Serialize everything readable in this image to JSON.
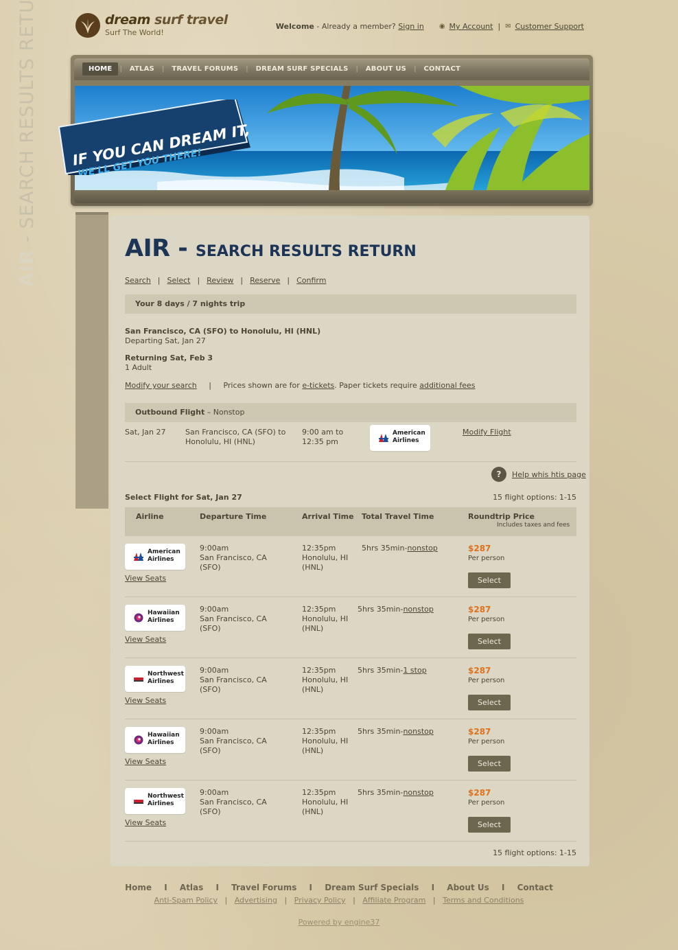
{
  "brand": {
    "name_part1": "dream",
    "name_part2": "surf travel",
    "tagline": "Surf The World!"
  },
  "topbar": {
    "welcome": "Welcome",
    "member_text": " - Already a member? ",
    "sign_in": "Sign in",
    "my_account": "My Account",
    "separator": "|",
    "customer_support": "Customer Support"
  },
  "nav": {
    "items": [
      "HOME",
      "ATLAS",
      "TRAVEL FORUMS",
      "DREAM SURF SPECIALS",
      "ABOUT US",
      "CONTACT"
    ],
    "separator": "|"
  },
  "banner": {
    "slogan_line1": "IF YOU CAN DREAM IT,",
    "slogan_line2": "WE'LL GET YOU THERE!"
  },
  "side_tab": {
    "bold": "AIR",
    "rest": " - SEARCH RESULTS RETURN"
  },
  "page": {
    "title_big": "AIR - ",
    "title_small": "SEARCH RESULTS RETURN",
    "steps": [
      "Search",
      "Select",
      "Review",
      "Reserve",
      "Confirm"
    ],
    "step_separator": "|",
    "trip_bar": "Your 8 days / 7 nights trip",
    "route_title": "San Francisco, CA (SFO) to Honolulu, HI (HNL)",
    "departing": "Departing Sat, Jan 27",
    "returning": "Returning Sat, Feb 3",
    "travelers": "1 Adult",
    "modify_search": "Modify your search",
    "prices_text": "Prices shown are for ",
    "etickets": "e-tickets",
    "paper_text": ". Paper tickets require ",
    "additional_fees": "additional fees"
  },
  "outbound": {
    "label": "Outbound Flight",
    "suffix": " – Nonstop",
    "date": "Sat, Jan 27",
    "route_line1": "San Francisco, CA (SFO) to",
    "route_line2": "Honolulu, HI (HNL)",
    "time_line1": "9:00 am to",
    "time_line2": "12:35 pm",
    "airline": "American Airlines",
    "modify": "Modify Flight"
  },
  "help": {
    "icon": "?",
    "text": "Help whis htis page"
  },
  "select": {
    "heading": "Select Flight for Sat, Jan 27",
    "options": "15 flight options: 1-15",
    "columns": {
      "airline": "Airline",
      "departure": "Departure Time",
      "arrival": "Arrival Time",
      "travel": "Total Travel Time",
      "price": "Roundtrip Price",
      "price_sub": "Includes taxes and fees"
    },
    "rows": [
      {
        "airline_l1": "American",
        "airline_l2": "Airlines",
        "dep_time": "9:00am",
        "dep_city": "San Francisco, CA",
        "dep_code": "(SFO)",
        "arr_time": "12:35pm",
        "arr_city": "Honolulu, HI",
        "arr_code": "(HNL)",
        "duration": "5hrs 35min-",
        "stops": "nonstop",
        "price": "$287",
        "per": "Per person",
        "select": "Select",
        "view": "View Seats"
      },
      {
        "airline_l1": "Hawaiian",
        "airline_l2": "Airlines",
        "dep_time": "9:00am",
        "dep_city": "San Francisco, CA",
        "dep_code": "(SFO)",
        "arr_time": "12:35pm",
        "arr_city": "Honolulu, HI",
        "arr_code": "(HNL)",
        "duration": "5hrs 35min-",
        "stops": "nonstop",
        "price": "$287",
        "per": "Per person",
        "select": "Select",
        "view": "View Seats"
      },
      {
        "airline_l1": "Northwest",
        "airline_l2": "Airlines",
        "dep_time": "9:00am",
        "dep_city": "San Francisco, CA",
        "dep_code": "(SFO)",
        "arr_time": "12:35pm",
        "arr_city": "Honolulu, HI",
        "arr_code": "(HNL)",
        "duration": "5hrs 35min-",
        "stops": "1 stop",
        "price": "$287",
        "per": "Per person",
        "select": "Select",
        "view": "View Seats"
      },
      {
        "airline_l1": "Hawaiian",
        "airline_l2": "Airlines",
        "dep_time": "9:00am",
        "dep_city": "San Francisco, CA",
        "dep_code": "(SFO)",
        "arr_time": "12:35pm",
        "arr_city": "Honolulu, HI",
        "arr_code": "(HNL)",
        "duration": "5hrs 35min-",
        "stops": "nonstop",
        "price": "$287",
        "per": "Per person",
        "select": "Select",
        "view": "View Seats"
      },
      {
        "airline_l1": "Northwest",
        "airline_l2": "Airlines",
        "dep_time": "9:00am",
        "dep_city": "San Francisco, CA",
        "dep_code": "(SFO)",
        "arr_time": "12:35pm",
        "arr_city": "Honolulu, HI",
        "arr_code": "(HNL)",
        "duration": "5hrs 35min-",
        "stops": "nonstop",
        "price": "$287",
        "per": "Per person",
        "select": "Select",
        "view": "View Seats"
      }
    ],
    "footer_options": "15 flight options: 1-15"
  },
  "footer": {
    "main_links": [
      "Home",
      "Atlas",
      "Travel Forums",
      "Dream Surf Specials",
      "About Us",
      "Contact"
    ],
    "main_separator": "I",
    "sub_links": [
      "Anti-Spam Policy",
      "Advertising",
      "Privacy Policy",
      "Affiliate Program",
      "Terms and Conditions"
    ],
    "sub_separator": "|",
    "powered": "Powered by engine37"
  },
  "colors": {
    "background": "#d9ccaa",
    "panel": "#dbd7c4",
    "title": "#1c3557",
    "price": "#e0711c",
    "button": "#6e6750"
  }
}
